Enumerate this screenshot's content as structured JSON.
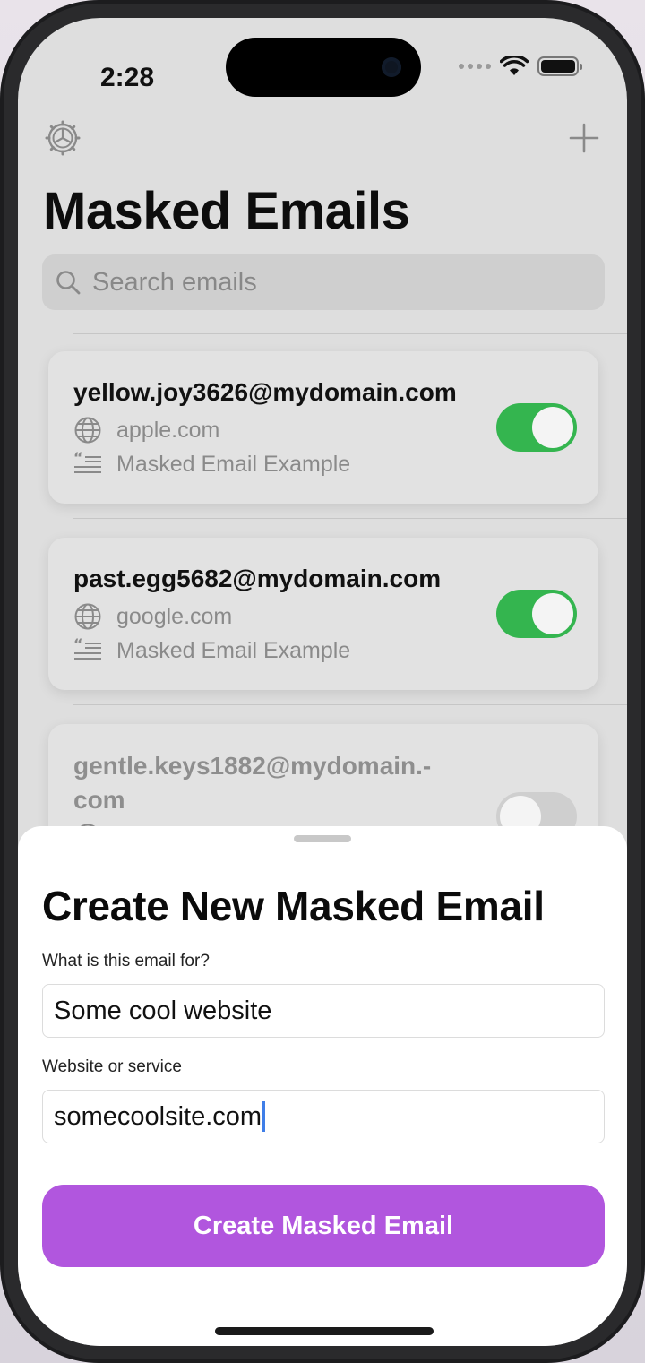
{
  "status": {
    "time": "2:28"
  },
  "header": {
    "settings_icon": "settings-icon",
    "add_icon": "plus-icon",
    "title": "Masked Emails"
  },
  "search": {
    "placeholder": "Search emails"
  },
  "emails": [
    {
      "address": "yellow.joy3626@mydomain.com",
      "domain": "apple.com",
      "description": "Masked Email Example",
      "enabled": true
    },
    {
      "address": "past.egg5682@mydomain.com",
      "domain": "google.com",
      "description": "Masked Email Example",
      "enabled": true
    },
    {
      "address_line1": "gentle.keys1882@mydomain.-",
      "address_line2": "com",
      "enabled": false
    }
  ],
  "sheet": {
    "title": "Create New Masked Email",
    "purpose_label": "What is this email for?",
    "purpose_value": "Some cool website",
    "site_label": "Website or service",
    "site_value": "somecoolsite.com",
    "submit_label": "Create Masked Email"
  },
  "colors": {
    "accent": "#b156de",
    "toggle_on": "#34b54f"
  }
}
